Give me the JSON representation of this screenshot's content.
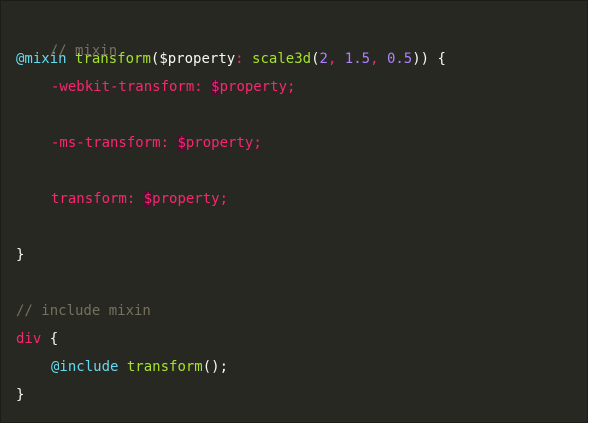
{
  "code": {
    "comment_mixin": "// mixin",
    "mixin_keyword": "@mixin",
    "mixin_name": "transform",
    "open_paren": "(",
    "param_var": "$property",
    "param_colon": ":",
    "default_fn": "scale3d",
    "default_open": "(",
    "arg1": "2",
    "arg_sep1": ", ",
    "arg2": "1.5",
    "arg_sep2": ", ",
    "arg3": "0.5",
    "close_parens": "))",
    "open_brace": " {",
    "prop_webkit": "-webkit-transform",
    "prop_ms": "-ms-transform",
    "prop_std": "transform",
    "prop_colon": ": ",
    "dollar": "$",
    "var_name": "property",
    "semicolon": ";",
    "close_brace": "}",
    "comment_include": "// include mixin",
    "selector": "div",
    "include_keyword": "@include",
    "include_name": "transform",
    "include_args": "();"
  }
}
